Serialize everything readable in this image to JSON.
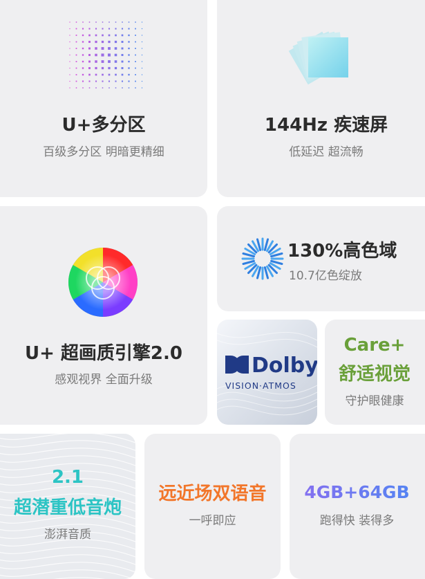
{
  "cards": {
    "zones": {
      "title": "U+多分区",
      "subtitle": "百级多分区  明暗更精细"
    },
    "refresh": {
      "title": "144Hz 疾速屏",
      "subtitle": "低延迟 超流畅"
    },
    "engine": {
      "title": "U+ 超画质引擎2.0",
      "subtitle": "感观视界 全面升级"
    },
    "gamut": {
      "title": "130%高色域",
      "subtitle": "10.7亿色绽放"
    },
    "dolby": {
      "brand": "Dolby",
      "subtitle": "VISION·ATMOS"
    },
    "care": {
      "title_line1": "Care+",
      "title_line2": "舒适视觉",
      "subtitle": "守护眼健康"
    },
    "bass": {
      "title_line1": "2.1",
      "title_line2": "超潜重低音炮",
      "subtitle": "澎湃音质"
    },
    "voice": {
      "title": "远近场双语音",
      "subtitle": "一呼即应"
    },
    "storage": {
      "title": "4GB+64GB",
      "subtitle": "跑得快 装得多"
    }
  },
  "colors": {
    "card_bg": "#efeff1",
    "care_green": "#6aa03a",
    "bass_cyan": "#2cc4c4",
    "voice_orange": "#f2762a",
    "storage_purple": "#8a6ef0",
    "storage_blue": "#4f86f2",
    "gamut_blue": "#2f7fe0",
    "dolby_navy": "#203a86"
  },
  "icons": [
    "dot-matrix-icon",
    "stacked-panels-icon",
    "rgb-color-wheel-icon",
    "radial-burst-icon",
    "dolby-logo-icon"
  ]
}
